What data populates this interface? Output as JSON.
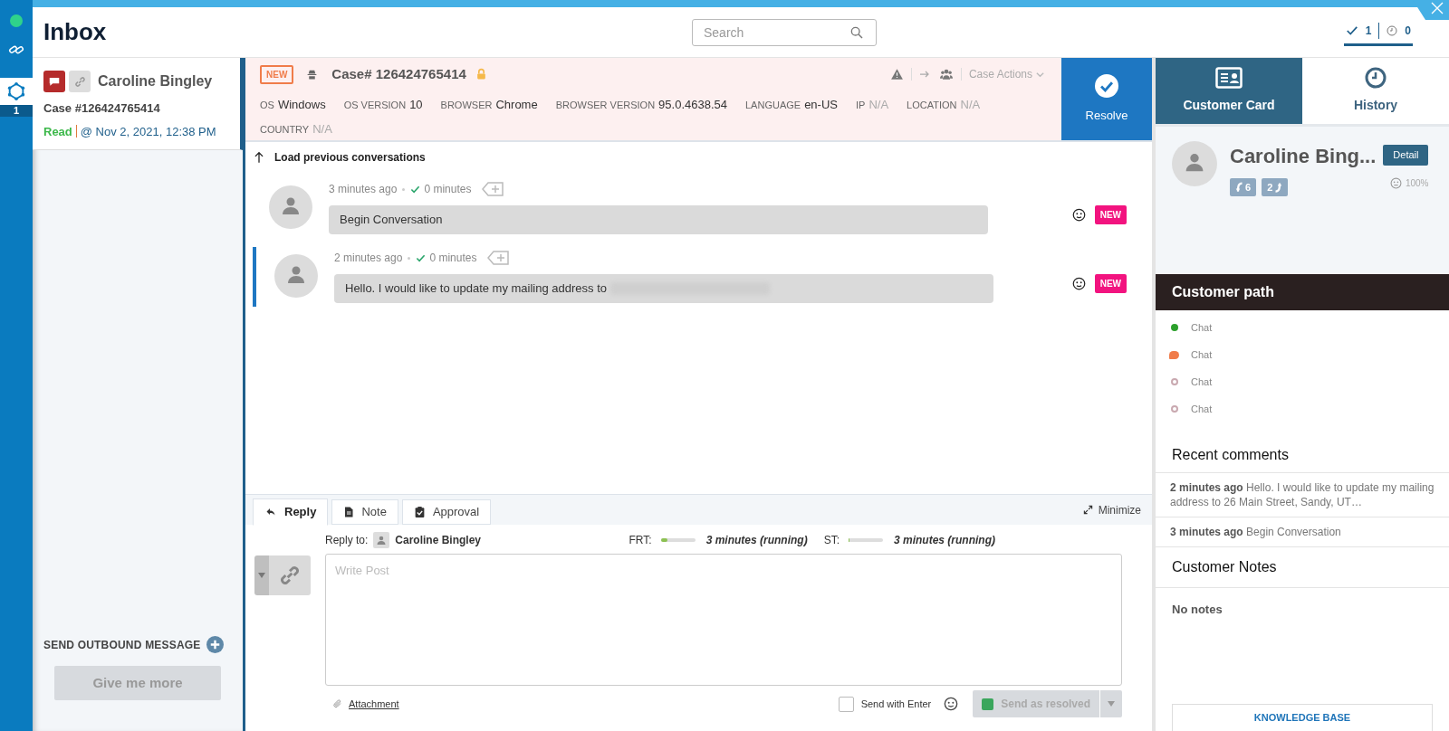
{
  "rail": {
    "badge": "1"
  },
  "header": {
    "title": "Inbox",
    "search": {
      "placeholder": "Search"
    },
    "counters": [
      {
        "kind": "done",
        "value": "1"
      },
      {
        "kind": "pending",
        "value": "0"
      }
    ]
  },
  "case_list": [
    {
      "name": "Caroline Bingley",
      "case": "Case #126424765414",
      "status": "Read",
      "time": "@ Nov 2, 2021, 12:38 PM",
      "selected": true
    }
  ],
  "outbound": {
    "label": "SEND OUTBOUND MESSAGE",
    "button": "Give me more"
  },
  "case_header": {
    "badge": "NEW",
    "title": "Case# 126424765414",
    "locked": true,
    "actions": "Case Actions",
    "fields": [
      {
        "label": "OS",
        "value": "Windows",
        "muted": false
      },
      {
        "label": "OS VERSION",
        "value": "10",
        "muted": false
      },
      {
        "label": "BROWSER",
        "value": "Chrome",
        "muted": false
      },
      {
        "label": "BROWSER VERSION",
        "value": "95.0.4638.54",
        "muted": false
      },
      {
        "label": "LANGUAGE",
        "value": "en-US",
        "muted": false
      },
      {
        "label": "IP",
        "value": "N/A",
        "muted": true
      },
      {
        "label": "LOCATION",
        "value": "N/A",
        "muted": true
      },
      {
        "label": "COUNTRY",
        "value": "N/A",
        "muted": true
      }
    ]
  },
  "resolve": "Resolve",
  "load_previous": "Load previous conversations",
  "messages": [
    {
      "time": "3 minutes ago",
      "duration": "0 minutes",
      "text": "Begin Conversation",
      "redacted": false,
      "badge": "NEW",
      "selected": false
    },
    {
      "time": "2 minutes ago",
      "duration": "0 minutes",
      "text": "Hello. I would like to update my mailing address to",
      "redacted": true,
      "badge": "NEW",
      "selected": true
    }
  ],
  "composer": {
    "tabs": [
      {
        "label": "Reply",
        "kind": "reply",
        "selected": true
      },
      {
        "label": "Note",
        "kind": "note",
        "selected": false
      },
      {
        "label": "Approval",
        "kind": "approval",
        "selected": false
      }
    ],
    "minimize": "Minimize",
    "reply_to_label": "Reply to:",
    "reply_to": "Caroline Bingley",
    "timers": [
      {
        "label": "FRT:",
        "level": 0.2,
        "reading": "3 minutes (running)"
      },
      {
        "label": "ST:",
        "level": 0.03,
        "reading": "3 minutes (running)"
      }
    ],
    "placeholder": "Write Post",
    "attachment": "Attachment",
    "send_with_enter": {
      "label": "Send with Enter",
      "checked": false
    },
    "send_button": {
      "label": "Send as resolved",
      "disabled": true
    }
  },
  "right": {
    "tabs": [
      {
        "label": "Customer Card",
        "kind": "card",
        "selected": true
      },
      {
        "label": "History",
        "kind": "history",
        "selected": false
      }
    ],
    "customer": {
      "name": "Caroline Bing...",
      "detail": "Detail",
      "inbound": "6",
      "outbound": "2",
      "sentiment": "100%"
    },
    "path": {
      "title": "Customer path",
      "items": [
        {
          "label": "Chat",
          "kind": "dot",
          "color": "#2ca02c"
        },
        {
          "label": "Chat",
          "kind": "bubble",
          "color": "#f07c4a"
        },
        {
          "label": "Chat",
          "kind": "ring",
          "color": "#c9a9b0"
        },
        {
          "label": "Chat",
          "kind": "ring",
          "color": "#c9a9b0"
        }
      ]
    },
    "comments": {
      "title": "Recent comments",
      "items": [
        {
          "time": "2 minutes ago",
          "text": "Hello. I would like to update my mailing address to 26 Main Street, Sandy, UT…"
        },
        {
          "time": "3 minutes ago",
          "text": "Begin Conversation"
        }
      ]
    },
    "notes": {
      "title": "Customer Notes",
      "empty": "No notes"
    },
    "knowledge_base": "KNOWLEDGE BASE"
  }
}
